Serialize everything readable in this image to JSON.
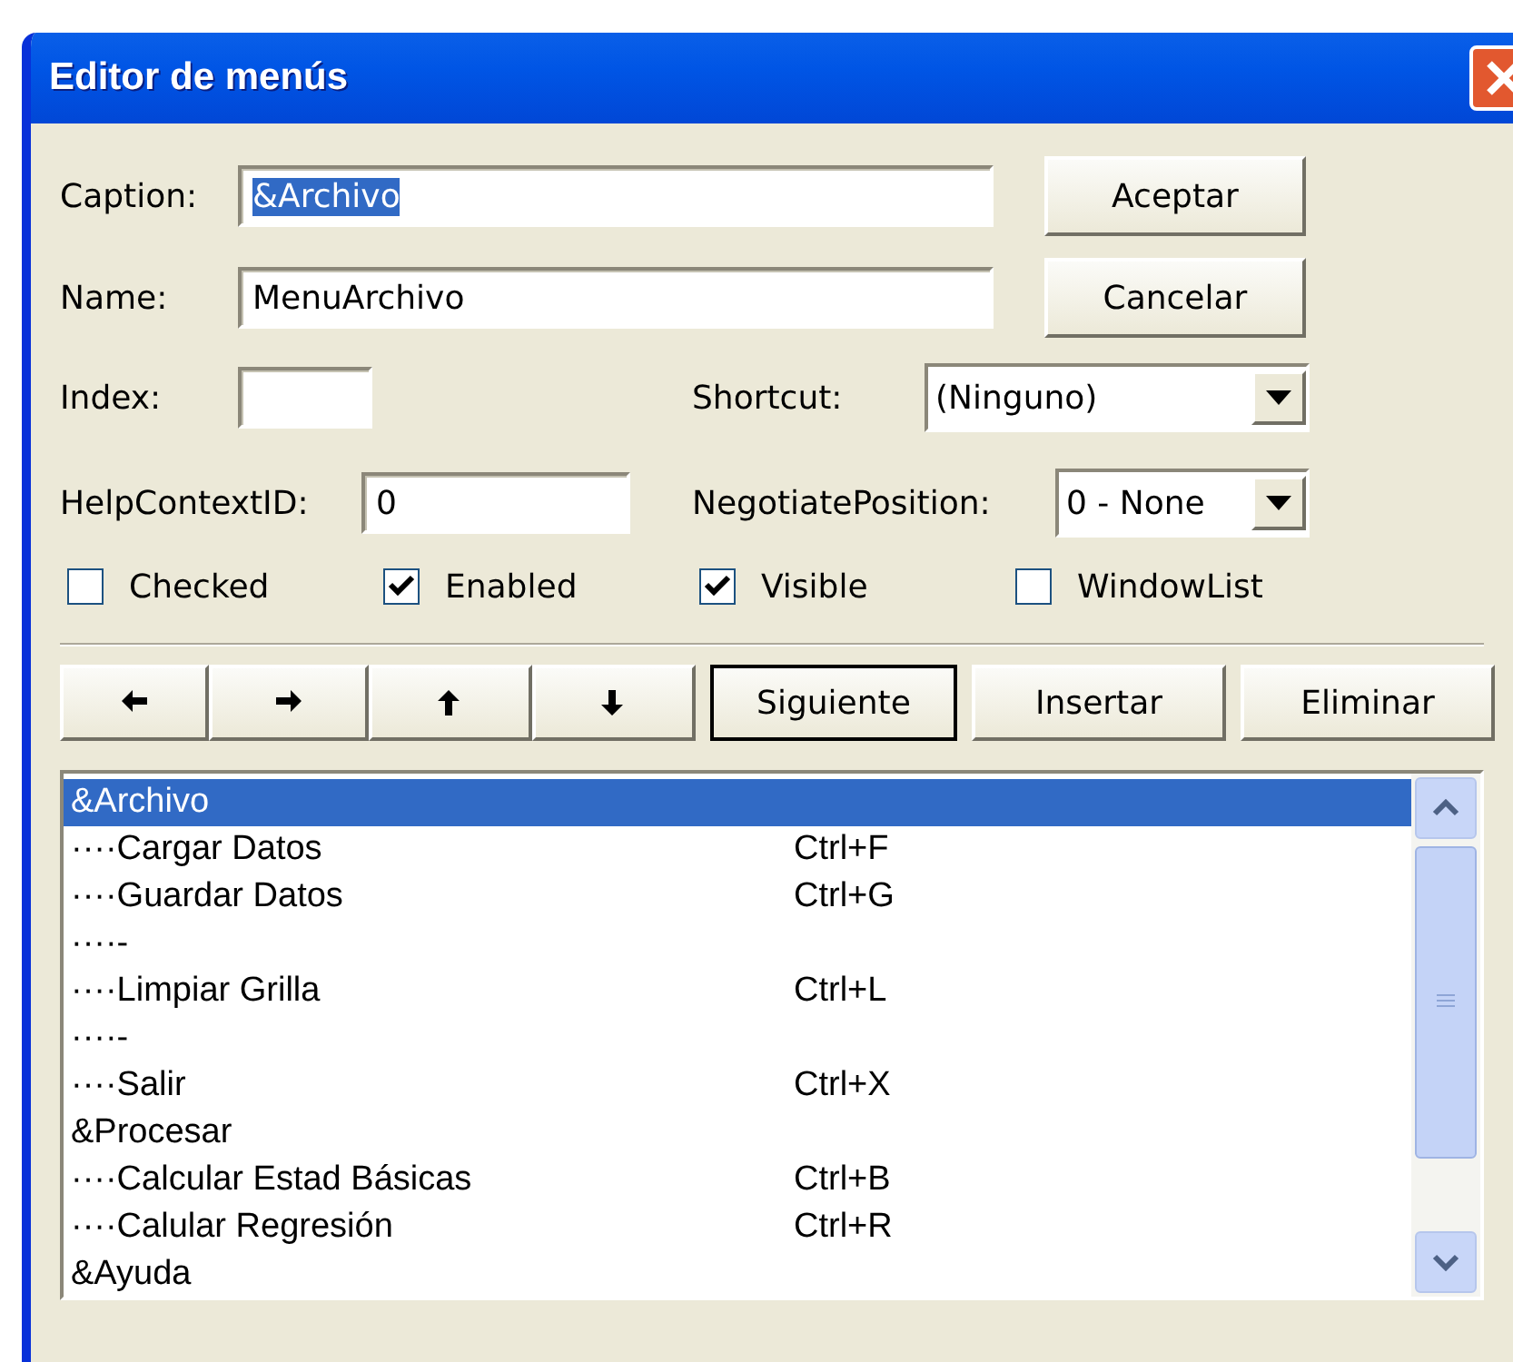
{
  "window": {
    "title": "Editor de menús"
  },
  "caption": {
    "label": "Caption:",
    "value": "&Archivo",
    "text_selected": true
  },
  "name": {
    "label": "Name:",
    "value": "MenuArchivo"
  },
  "index": {
    "label": "Index:"
  },
  "shortcut": {
    "label": "Shortcut:",
    "value": "(Ninguno)"
  },
  "help_context_id": {
    "label": "HelpContextID:",
    "value": "0"
  },
  "negotiate_position": {
    "label": "NegotiatePosition:",
    "value": "0 - None"
  },
  "checkboxes": [
    {
      "label": "Checked",
      "checked": false
    },
    {
      "label": "Enabled",
      "checked": true
    },
    {
      "label": "Visible",
      "checked": true
    },
    {
      "label": "WindowList",
      "checked": false
    }
  ],
  "buttons": {
    "ok": "Aceptar",
    "cancel": "Cancelar"
  },
  "arrow_buttons": [
    {
      "kind": "left"
    },
    {
      "kind": "right"
    },
    {
      "kind": "up"
    },
    {
      "kind": "down"
    }
  ],
  "action_buttons": [
    {
      "label": "Siguiente",
      "default": true
    },
    {
      "label": "Insertar",
      "default": false
    },
    {
      "label": "Eliminar",
      "default": false
    }
  ],
  "menu_list": [
    {
      "caption": "&Archivo",
      "selected": true
    },
    {
      "caption": "····Cargar Datos",
      "shortcut": "Ctrl+F",
      "selected": false
    },
    {
      "caption": "····Guardar Datos",
      "shortcut": "Ctrl+G",
      "selected": false
    },
    {
      "caption": "····-",
      "selected": false
    },
    {
      "caption": "····Limpiar Grilla",
      "shortcut": "Ctrl+L",
      "selected": false
    },
    {
      "caption": "····-",
      "selected": false
    },
    {
      "caption": "····Salir",
      "shortcut": "Ctrl+X",
      "selected": false
    },
    {
      "caption": "&Procesar",
      "selected": false
    },
    {
      "caption": "····Calcular Estad Básicas",
      "shortcut": "Ctrl+B",
      "selected": false
    },
    {
      "caption": "····Calular Regresión",
      "shortcut": "Ctrl+R",
      "selected": false
    },
    {
      "caption": "&Ayuda",
      "selected": false
    }
  ]
}
